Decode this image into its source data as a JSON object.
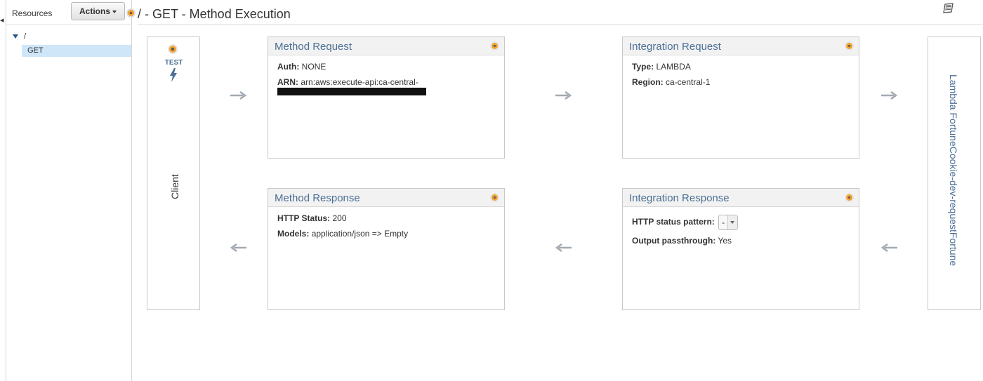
{
  "sidebar": {
    "title": "Resources",
    "actions_label": "Actions",
    "tree": {
      "root": "/",
      "selected_method": "GET"
    }
  },
  "header": {
    "title": "/ - GET - Method Execution"
  },
  "client": {
    "test_label": "TEST",
    "label": "Client"
  },
  "method_request": {
    "title": "Method Request",
    "auth_label": "Auth:",
    "auth_value": "NONE",
    "arn_label": "ARN:",
    "arn_value": "arn:aws:execute-api:ca-central-"
  },
  "integration_request": {
    "title": "Integration Request",
    "type_label": "Type:",
    "type_value": "LAMBDA",
    "region_label": "Region:",
    "region_value": "ca-central-1"
  },
  "method_response": {
    "title": "Method Response",
    "status_label": "HTTP Status:",
    "status_value": "200",
    "models_label": "Models:",
    "models_value": "application/json => Empty"
  },
  "integration_response": {
    "title": "Integration Response",
    "pattern_label": "HTTP status pattern:",
    "pattern_value": "-",
    "passthrough_label": "Output passthrough:",
    "passthrough_value": "Yes"
  },
  "lambda": {
    "label": "Lambda FortuneCookie-dev-requestFortune"
  },
  "colors": {
    "accent_blue": "#4b6f95",
    "help_orange": "#f0a030",
    "arrow_gray": "#a3aab3",
    "selected_bg": "#cfe6f8"
  },
  "icons": {
    "help": "help-dot-icon",
    "test": "lightning-bolt-icon",
    "docs": "book-icon"
  }
}
